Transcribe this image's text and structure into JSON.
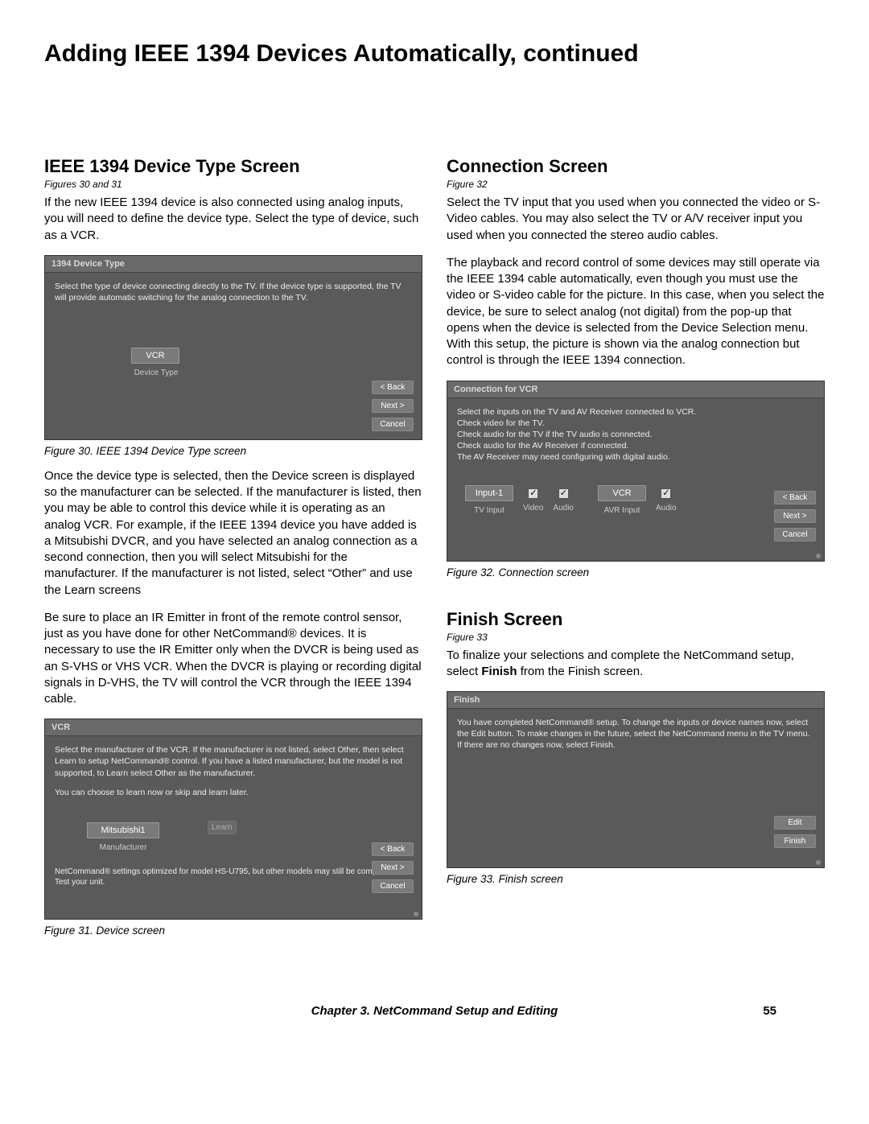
{
  "page_title": "Adding IEEE 1394 Devices Automatically, continued",
  "footer": {
    "chapter": "Chapter 3. NetCommand Setup and Editing",
    "page": "55"
  },
  "left": {
    "heading1": "IEEE 1394 Device Type Screen",
    "figref1": "Figures 30 and 31",
    "para1": "If the new IEEE 1394 device is also connected using analog inputs, you will need to define the device type.  Select the type of device, such as a VCR.",
    "dlg1": {
      "title": "1394 Device Type",
      "instr": "Select the type of device connecting directly to the TV.  If the device type is supported, the TV will provide automatic switching for the analog connection to the TV.",
      "field_value": "VCR",
      "field_label": "Device Type",
      "back": "< Back",
      "next": "Next >",
      "cancel": "Cancel"
    },
    "caption1": "Figure 30. IEEE 1394 Device Type screen",
    "para2": "Once the device type is selected, then the Device screen is displayed so the manufacturer can be selected. If the manufacturer is listed, then you may be able to control this device while it is operating as an analog VCR.  For example, if the IEEE 1394 device you have added is a Mitsubishi DVCR, and you have selected an analog connection as a second connection, then you will select Mitsubishi for the manufacturer.  If the manufacturer is not listed, select “Other” and use the Learn screens",
    "para3": "Be sure to place an IR Emitter in front of the remote control sensor, just as you have done for other NetCommand® devices.  It is necessary to use the IR Emitter only when the DVCR is being used as an S-VHS or VHS VCR.  When the DVCR is playing or recording digital signals in D-VHS, the TV will control the VCR through the IEEE 1394 cable.",
    "dlg2": {
      "title": "VCR",
      "instr1": "Select the manufacturer of the VCR.   If the manufacturer is not listed, select Other, then select Learn to setup NetCommand® control. If you have a listed manufacturer, but the model is not supported, to Learn select Other as the manufacturer.",
      "instr2": "You can choose to learn now or skip and learn later.",
      "field_value": "Mitsubishi1",
      "field_label": "Manufacturer",
      "learn": "Learn",
      "note": "NetCommand® settings optimized for model HS-U795, but other models may still be compatible. Test your unit.",
      "back": "< Back",
      "next": "Next >",
      "cancel": "Cancel"
    },
    "caption2": "Figure 31.  Device  screen"
  },
  "right": {
    "heading1": "Connection Screen",
    "figref1": "Figure 32",
    "para1": "Select the TV input that you used when you connected the video or S-Video cables.  You may also select the TV or A/V receiver input you used when you connected the stereo audio cables.",
    "para2": "The playback and record control of some devices may still operate via the IEEE 1394 cable automatically, even though you must use the video or S-video cable for the picture.  In this case, when you select the device, be sure to select analog (not digital) from the pop-up that opens when the device is selected from the Device Selection menu.  With this setup, the picture is shown via the analog connection but control is through the IEEE 1394 connection.",
    "dlg1": {
      "title": "Connection for VCR",
      "instr_l1": "Select the inputs on the TV and AV Receiver connected to VCR.",
      "instr_l2": "Check video for the TV.",
      "instr_l3": "Check audio for the TV if the TV audio is connected.",
      "instr_l4": "Check audio for the AV Receiver if connected.",
      "instr_l5": "The AV Receiver may need configuring with digital audio.",
      "tv_input_value": "Input-1",
      "tv_input_label": "TV Input",
      "video_label": "Video",
      "audio_label": "Audio",
      "avr_value": "VCR",
      "avr_label": "AVR Input",
      "audio2_label": "Audio",
      "back": "< Back",
      "next": "Next >",
      "cancel": "Cancel"
    },
    "caption1": "Figure 32. Connection screen",
    "heading2": "Finish Screen",
    "figref2": "Figure 33",
    "para3a": "To finalize your selections and complete the NetCommand setup, select ",
    "para3b": "Finish",
    "para3c": " from the Finish screen.",
    "dlg2": {
      "title": "Finish",
      "instr": "You have completed NetCommand® setup.  To change the inputs or device names now, select the Edit button.  To make changes in the future, select the NetCommand menu in the TV menu.  If there are no changes now, select Finish.",
      "edit": "Edit",
      "finish": "Finish"
    },
    "caption2": "Figure 33. Finish screen"
  }
}
